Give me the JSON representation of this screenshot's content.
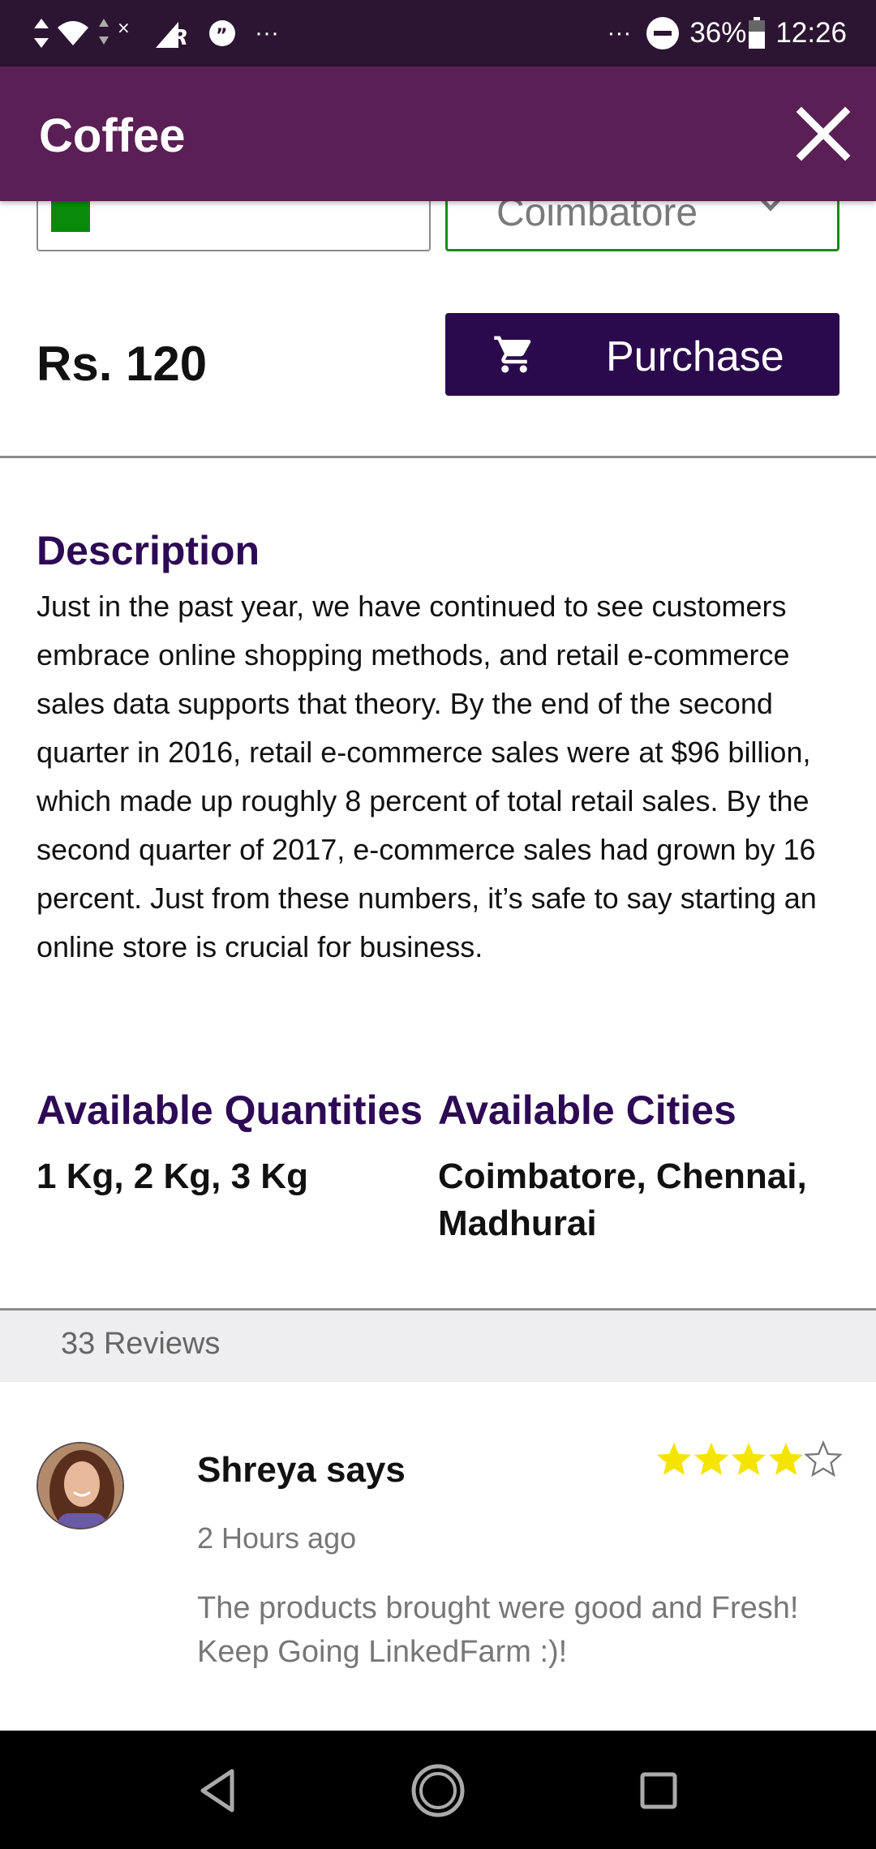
{
  "status_bar": {
    "overflow_left": "···",
    "overflow_right": "···",
    "battery_percent": "36%",
    "time": "12:26",
    "icons": [
      "data-arrows-icon",
      "wifi-icon",
      "signal-icon",
      "roaming-signal-icon",
      "quote-notification-icon",
      "do-not-disturb-icon",
      "battery-icon"
    ]
  },
  "app_bar": {
    "title": "Coffee",
    "close_icon": "close-icon"
  },
  "selectors": {
    "color_swatch": "#0a8a0a",
    "city_value": "Coimbatore"
  },
  "product": {
    "price": "Rs. 120",
    "purchase_label": "Purchase"
  },
  "description": {
    "heading": "Description",
    "body": "Just in the past year, we have continued to see customers embrace online shopping methods, and retail e-commerce sales data supports that theory. By the end of the second quarter in 2016, retail e-commerce sales were at $96 billion, which made up roughly 8 percent of total retail sales. By the second quarter of 2017, e-commerce sales had grown by 16 percent. Just from these numbers, it’s safe to say starting an online store is crucial for business."
  },
  "availability": {
    "quantities_heading": "Available Quantities",
    "quantities_value": "1 Kg, 2 Kg, 3 Kg",
    "cities_heading": "Available Cities",
    "cities_value": "Coimbatore, Chennai, Madhurai"
  },
  "reviews": {
    "count_label": "33 Reviews",
    "items": [
      {
        "name": "Shreya says",
        "time": "2 Hours ago",
        "text": "The products brought were good and Fresh! Keep Going LinkedFarm :)!",
        "rating": 4,
        "max_rating": 5
      }
    ]
  },
  "colors": {
    "status_bar": "#2c1533",
    "app_bar": "#5a1f55",
    "heading": "#2d0a55",
    "purchase_button": "#2a0a4c",
    "star_filled": "#f5e300"
  }
}
